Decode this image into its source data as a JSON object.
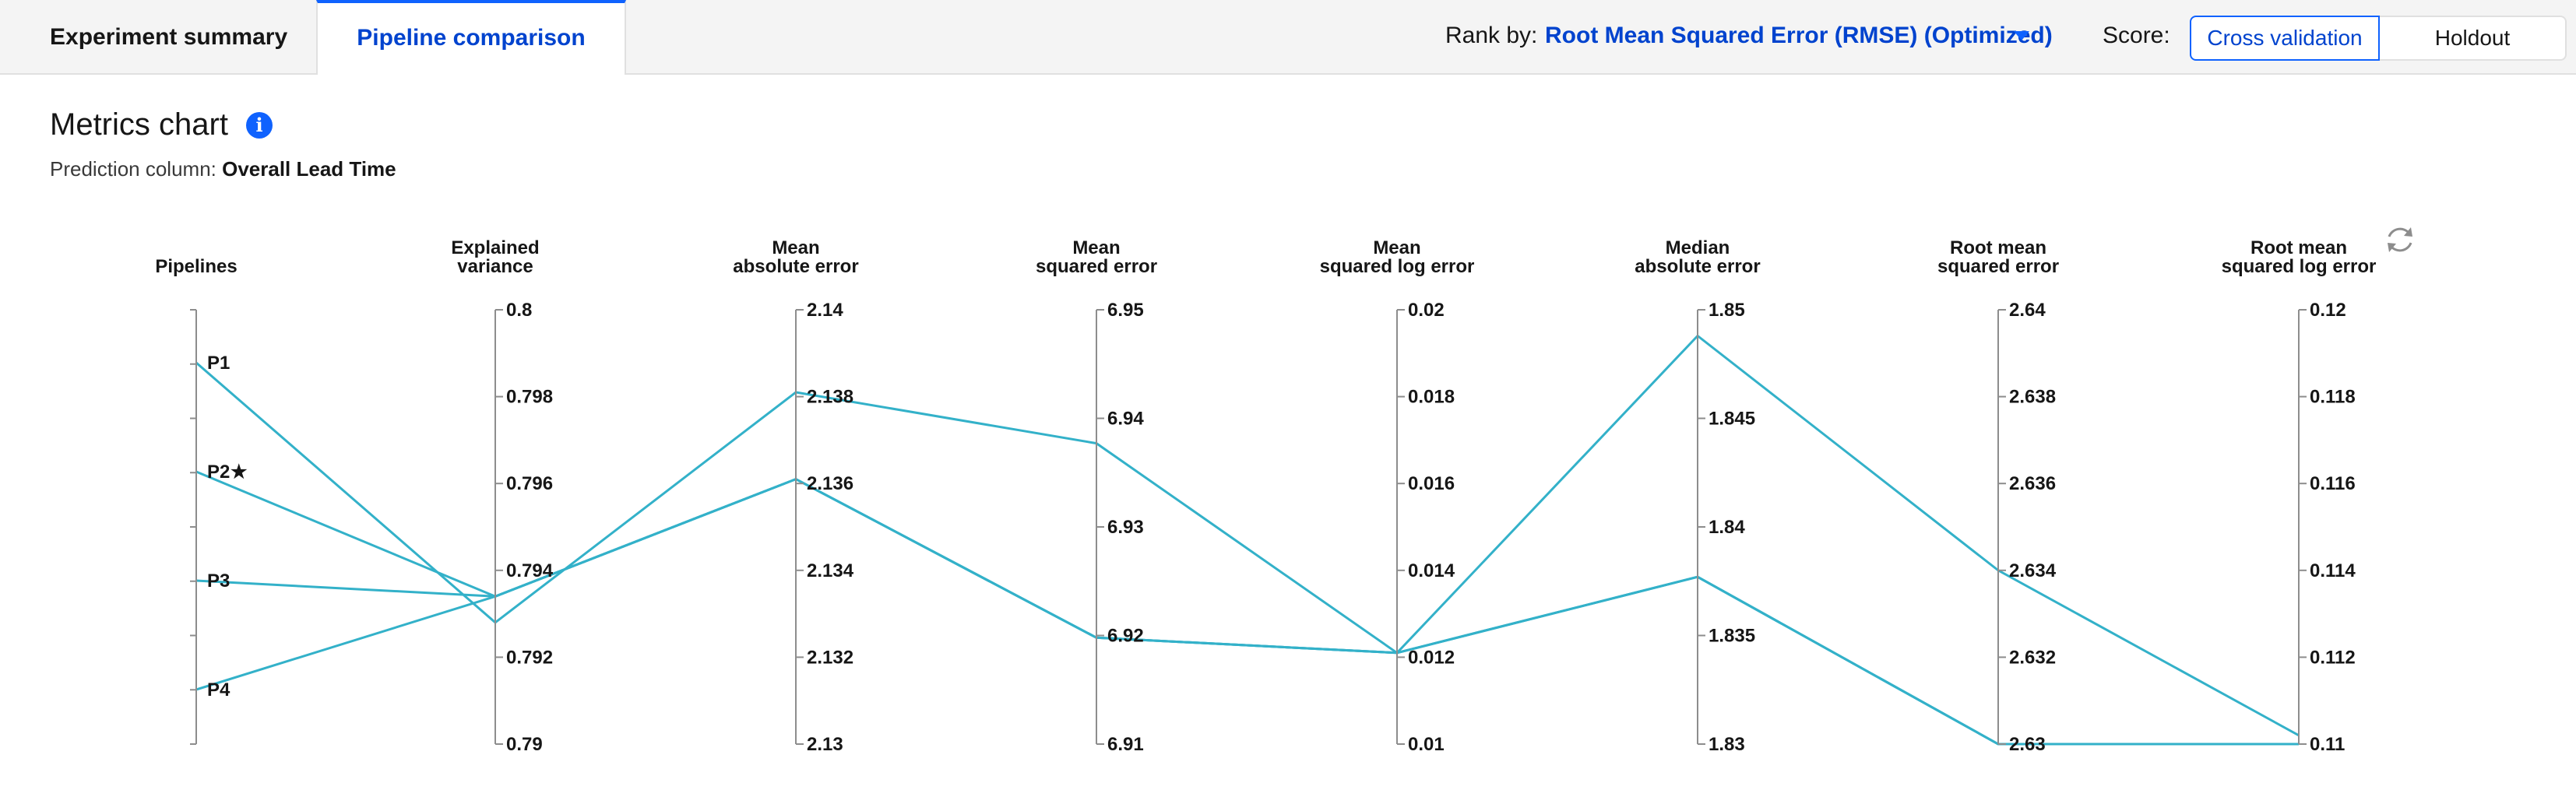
{
  "tabs": {
    "summary": "Experiment summary",
    "comparison": "Pipeline comparison"
  },
  "toolbar": {
    "rank_label": "Rank by:",
    "rank_value": "Root Mean Squared Error (RMSE) (Optimized)",
    "score_label": "Score:",
    "score_options": [
      "Cross validation",
      "Holdout"
    ],
    "score_selected": "Cross validation"
  },
  "page": {
    "title": "Metrics chart",
    "prediction_label": "Prediction column: ",
    "prediction_value": "Overall Lead Time"
  },
  "colors": {
    "accent": "#0f62fe",
    "line": "#33b1c9"
  },
  "icons": [
    "info-icon",
    "chevron-down-icon",
    "refresh-icon",
    "star-icon"
  ],
  "chart_data": {
    "type": "parallel-coordinates",
    "categories": [
      "P1",
      "P2",
      "P3",
      "P4"
    ],
    "starred": "P2",
    "axes": [
      {
        "title": [
          "Pipelines"
        ],
        "kind": "category"
      },
      {
        "title": [
          "Explained",
          "variance"
        ],
        "range": [
          0.79,
          0.8
        ],
        "ticks": [
          "0.8",
          "0.798",
          "0.796",
          "0.794",
          "0.792",
          "0.79"
        ]
      },
      {
        "title": [
          "Mean",
          "absolute error"
        ],
        "range": [
          2.13,
          2.14
        ],
        "ticks": [
          "2.14",
          "2.138",
          "2.136",
          "2.134",
          "2.132",
          "2.13"
        ]
      },
      {
        "title": [
          "Mean",
          "squared error"
        ],
        "range": [
          6.91,
          6.95
        ],
        "ticks": [
          "6.95",
          "6.94",
          "6.93",
          "6.92",
          "6.91"
        ]
      },
      {
        "title": [
          "Mean",
          "squared log error"
        ],
        "range": [
          0.01,
          0.02
        ],
        "ticks": [
          "0.02",
          "0.018",
          "0.016",
          "0.014",
          "0.012",
          "0.01"
        ]
      },
      {
        "title": [
          "Median",
          "absolute error"
        ],
        "range": [
          1.83,
          1.85
        ],
        "ticks": [
          "1.85",
          "1.845",
          "1.84",
          "1.835",
          "1.83"
        ]
      },
      {
        "title": [
          "Root mean",
          "squared error"
        ],
        "range": [
          2.63,
          2.64
        ],
        "ticks": [
          "2.64",
          "2.638",
          "2.636",
          "2.634",
          "2.632",
          "2.63"
        ]
      },
      {
        "title": [
          "Root mean",
          "squared log error"
        ],
        "range": [
          0.11,
          0.12
        ],
        "ticks": [
          "0.12",
          "0.118",
          "0.116",
          "0.114",
          "0.112",
          "0.11"
        ]
      }
    ],
    "series": [
      {
        "name": "P1",
        "values": [
          null,
          0.7928,
          2.1381,
          6.9377,
          0.0121,
          1.8488,
          2.634,
          0.1102
        ]
      },
      {
        "name": "P2",
        "values": [
          null,
          0.7934,
          2.1361,
          6.9198,
          0.0121,
          1.8377,
          2.63,
          0.11
        ]
      },
      {
        "name": "P3",
        "values": [
          null,
          0.7934,
          2.1361,
          6.9198,
          0.0121,
          1.8377,
          2.63,
          0.11
        ]
      },
      {
        "name": "P4",
        "values": [
          null,
          0.7934,
          2.1361,
          6.9198,
          0.0121,
          1.8377,
          2.63,
          0.11
        ]
      }
    ]
  }
}
